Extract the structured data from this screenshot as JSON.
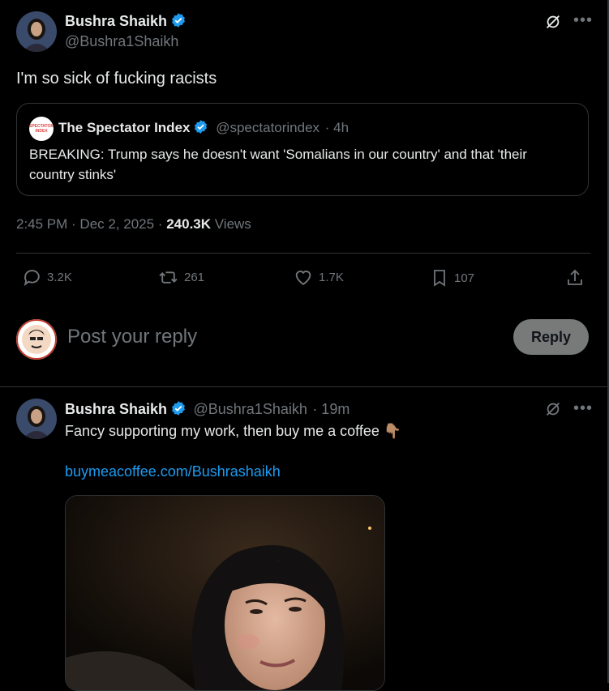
{
  "main_tweet": {
    "author_name": "Bushra Shaikh",
    "author_handle": "@Bushra1Shaikh",
    "text": "I'm so sick of fucking racists",
    "timestamp": "2:45 PM · Dec 2, 2025 · ",
    "views_count": "240.3K",
    "views_label": " Views",
    "quote": {
      "author_name": "The Spectator Index",
      "author_handle": "@spectatorindex",
      "time": "· 4h",
      "avatar_text_1": "SPECTATOR",
      "avatar_text_2": "INDEX",
      "text": "BREAKING: Trump says he doesn't want 'Somalians in our country' and that 'their country stinks'"
    },
    "actions": {
      "replies": "3.2K",
      "reposts": "261",
      "likes": "1.7K",
      "bookmarks": "107"
    }
  },
  "composer": {
    "placeholder": "Post your reply",
    "reply_button": "Reply"
  },
  "reply_tweet": {
    "author_name": "Bushra Shaikh",
    "author_handle": "@Bushra1Shaikh",
    "time": "· 19m",
    "text": "Fancy supporting my work, then buy me a coffee 👇🏽",
    "link": "buymeacoffee.com/Bushrashaikh"
  },
  "colors": {
    "background": "#000000",
    "accent": "#1d9bf0",
    "muted": "#71767b",
    "border": "#2f3336"
  }
}
